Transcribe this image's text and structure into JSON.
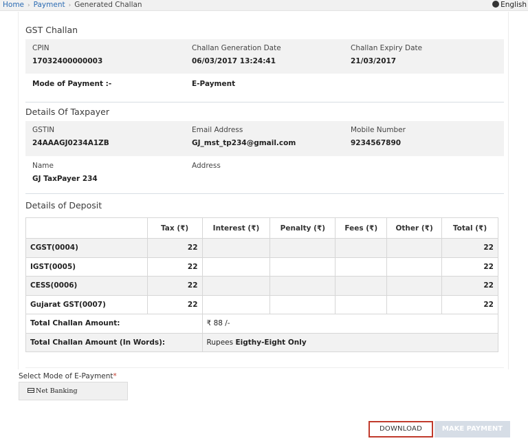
{
  "breadcrumb": {
    "home": "Home",
    "payment": "Payment",
    "current": "Generated Challan",
    "separator": "›"
  },
  "language": "English",
  "challan": {
    "title": "GST Challan",
    "cpin_label": "CPIN",
    "cpin_value": "17032400000003",
    "gen_date_label": "Challan Generation Date",
    "gen_date_value": "06/03/2017 13:24:41",
    "exp_date_label": "Challan Expiry Date",
    "exp_date_value": "21/03/2017",
    "mode_label": "Mode of Payment :-",
    "mode_value": "E-Payment"
  },
  "taxpayer": {
    "title": "Details Of Taxpayer",
    "gstin_label": "GSTIN",
    "gstin_value": "24AAAGJ0234A1ZB",
    "email_label": "Email Address",
    "email_value": "GJ_mst_tp234@gmail.com",
    "mobile_label": "Mobile Number",
    "mobile_value": "9234567890",
    "name_label": "Name",
    "name_value": "GJ TaxPayer 234",
    "address_label": "Address"
  },
  "deposit": {
    "title": "Details of Deposit",
    "headers": [
      "",
      "Tax (₹)",
      "Interest (₹)",
      "Penalty (₹)",
      "Fees (₹)",
      "Other (₹)",
      "Total (₹)"
    ],
    "rows": [
      {
        "name": "CGST(0004)",
        "tax": "22",
        "total": "22"
      },
      {
        "name": "IGST(0005)",
        "tax": "22",
        "total": "22"
      },
      {
        "name": "CESS(0006)",
        "tax": "22",
        "total": "22"
      },
      {
        "name": "Gujarat GST(0007)",
        "tax": "22",
        "total": "22"
      }
    ],
    "total_label": "Total Challan Amount:",
    "total_value": "₹ 88 /-",
    "words_label": "Total Challan Amount (In Words):",
    "words_prefix": "Rupees",
    "words_value": "Eigthy-Eight Only"
  },
  "epayment": {
    "label": "Select Mode of E-Payment",
    "required_mark": "*",
    "selected": "Net Banking"
  },
  "buttons": {
    "download": "DOWNLOAD",
    "make_payment": "MAKE PAYMENT"
  }
}
